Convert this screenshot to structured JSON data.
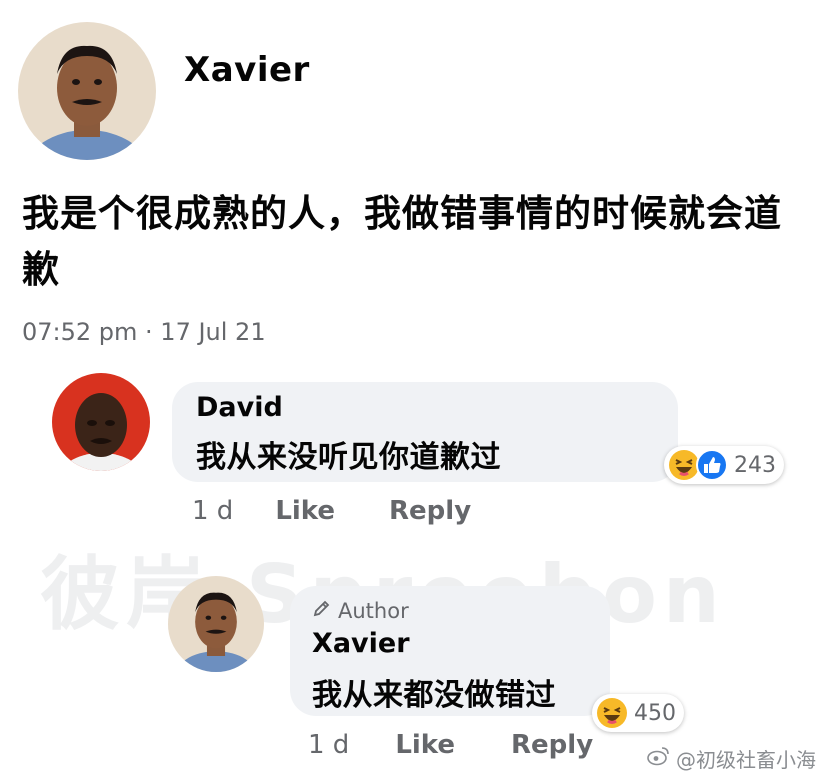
{
  "post": {
    "author": "Xavier",
    "text": "我是个很成熟的人，我做错事情的时候就会道歉",
    "timestamp": "07:52 pm · 17 Jul 21"
  },
  "comments": [
    {
      "name": "David",
      "text": "我从来没听见你道歉过",
      "age": "1 d",
      "like_label": "Like",
      "reply_label": "Reply",
      "reaction_count": "243",
      "reaction_icons": [
        "haha-icon",
        "like-icon"
      ]
    },
    {
      "badge": "Author",
      "name": "Xavier",
      "text": "我从来都没做错过",
      "age": "1 d",
      "like_label": "Like",
      "reply_label": "Reply",
      "reaction_count": "450",
      "reaction_icons": [
        "haha-icon"
      ]
    }
  ],
  "watermark": "彼岸 Spreebon",
  "credit": "@初级社畜小海",
  "colors": {
    "bubble": "#f0f2f5",
    "secondary_text": "#65676b",
    "like_blue": "#1877f2",
    "haha_yellow": "#f7b928"
  }
}
